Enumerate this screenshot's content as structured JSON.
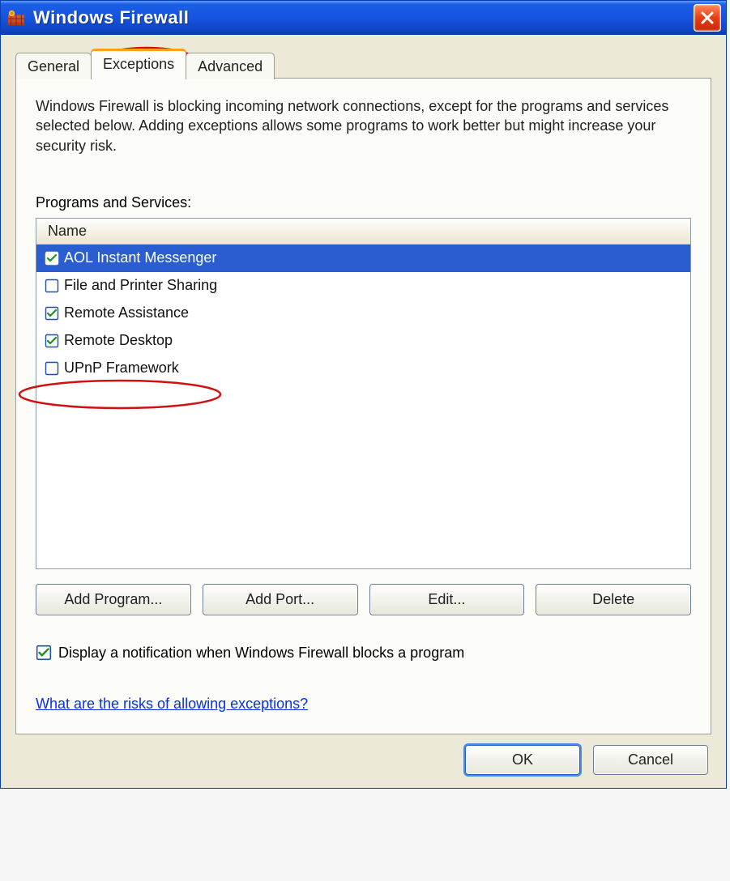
{
  "window": {
    "title": "Windows Firewall"
  },
  "tabs": {
    "general": "General",
    "exceptions": "Exceptions",
    "advanced": "Advanced"
  },
  "panel": {
    "description": "Windows Firewall is blocking incoming network connections, except for the programs and services selected below. Adding exceptions allows some programs to work better but might increase your security risk.",
    "list_label": "Programs and Services:",
    "column_header": "Name",
    "items": [
      {
        "label": "AOL Instant Messenger",
        "checked": true,
        "selected": true
      },
      {
        "label": "File and Printer Sharing",
        "checked": false,
        "selected": false
      },
      {
        "label": "Remote Assistance",
        "checked": true,
        "selected": false
      },
      {
        "label": "Remote Desktop",
        "checked": true,
        "selected": false
      },
      {
        "label": "UPnP Framework",
        "checked": false,
        "selected": false
      }
    ],
    "buttons": {
      "add_program": "Add Program...",
      "add_port": "Add Port...",
      "edit": "Edit...",
      "delete": "Delete"
    },
    "notify": {
      "checked": true,
      "label": "Display a notification when Windows Firewall blocks a program"
    },
    "help_link": "What are the risks of allowing exceptions?"
  },
  "dialog": {
    "ok": "OK",
    "cancel": "Cancel"
  }
}
